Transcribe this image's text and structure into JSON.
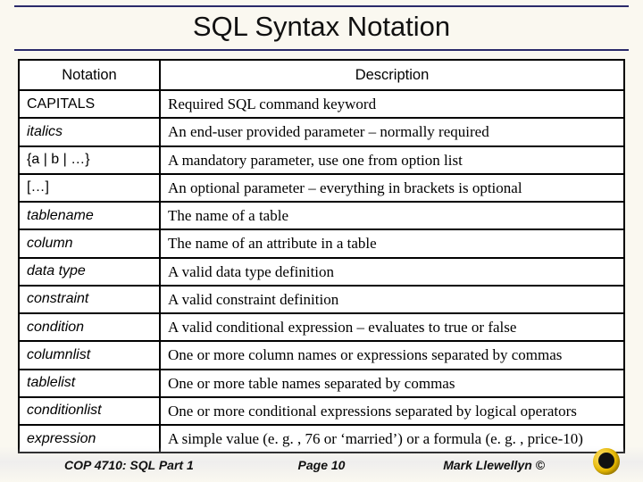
{
  "title": "SQL Syntax Notation",
  "headers": {
    "notation": "Notation",
    "description": "Description"
  },
  "rows": [
    {
      "notation": "CAPITALS",
      "italic": false,
      "description": "Required SQL command keyword"
    },
    {
      "notation": "italics",
      "italic": true,
      "description": "An end-user provided parameter – normally required"
    },
    {
      "notation": "{a | b | …}",
      "italic": false,
      "description": "A mandatory parameter, use one from option list"
    },
    {
      "notation": "[…]",
      "italic": false,
      "description": "An optional parameter – everything in brackets is optional"
    },
    {
      "notation": "tablename",
      "italic": true,
      "description": "The name of a table"
    },
    {
      "notation": "column",
      "italic": true,
      "description": "The name of an attribute in a table"
    },
    {
      "notation": "data type",
      "italic": true,
      "description": "A valid data type definition"
    },
    {
      "notation": "constraint",
      "italic": true,
      "description": "A valid constraint definition"
    },
    {
      "notation": "condition",
      "italic": true,
      "description": "A valid conditional expression – evaluates to true or false"
    },
    {
      "notation": "columnlist",
      "italic": true,
      "description": "One or more column names or expressions separated by commas"
    },
    {
      "notation": "tablelist",
      "italic": true,
      "description": "One or more table names separated by commas"
    },
    {
      "notation": "conditionlist",
      "italic": true,
      "description": "One or more conditional expressions separated by logical operators"
    },
    {
      "notation": "expression",
      "italic": true,
      "description": "A simple value (e. g. , 76 or ‘married’) or a formula (e. g. , price-10)"
    }
  ],
  "footer": {
    "course": "COP 4710: SQL Part 1",
    "page": "Page 10",
    "author": "Mark Llewellyn ©"
  }
}
